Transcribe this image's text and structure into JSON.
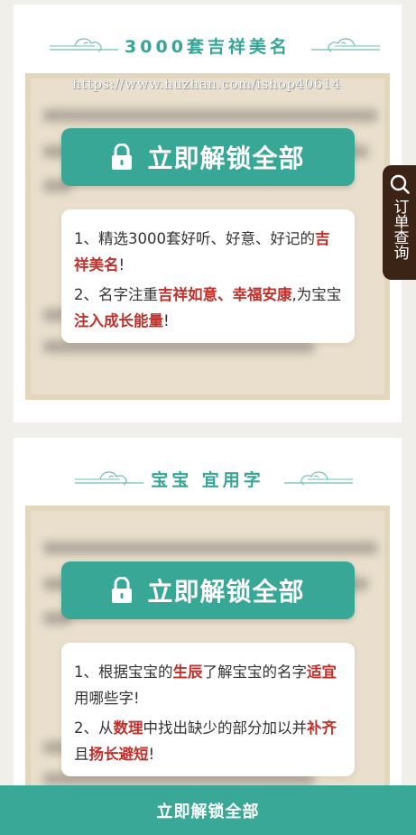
{
  "sections": [
    {
      "title": "3000套吉祥美名",
      "unlock_label": "立即解锁全部",
      "watermark": "https://www.huzhan.com/ishop40614",
      "items": [
        [
          {
            "t": "1、精选3000套好听、好意、好记的",
            "hl": false
          },
          {
            "t": "吉祥美名",
            "hl": true
          },
          {
            "t": "!",
            "hl": false
          }
        ],
        [
          {
            "t": "2、名字注重",
            "hl": false
          },
          {
            "t": "吉祥如意、幸福安康",
            "hl": true
          },
          {
            "t": ",为宝宝",
            "hl": false
          },
          {
            "t": "注入成长能量",
            "hl": true
          },
          {
            "t": "!",
            "hl": false
          }
        ]
      ]
    },
    {
      "title": "宝宝 宜用字",
      "unlock_label": "立即解锁全部",
      "items": [
        [
          {
            "t": "1、根据宝宝的",
            "hl": false
          },
          {
            "t": "生辰",
            "hl": true
          },
          {
            "t": "了解宝宝的名字",
            "hl": false
          },
          {
            "t": "适宜",
            "hl": true
          },
          {
            "t": "用哪些字!",
            "hl": false
          }
        ],
        [
          {
            "t": "2、从",
            "hl": false
          },
          {
            "t": "数理",
            "hl": true
          },
          {
            "t": "中找出缺少的部分加以并",
            "hl": false
          },
          {
            "t": "补齐",
            "hl": true
          },
          {
            "t": "且",
            "hl": false
          },
          {
            "t": "扬长避短",
            "hl": true
          },
          {
            "t": "!",
            "hl": false
          }
        ]
      ]
    }
  ],
  "side_tab": {
    "label": "订单查询",
    "icon": "search-icon"
  },
  "bottom_bar": {
    "label": "立即解锁全部"
  },
  "colors": {
    "accent": "#38a796",
    "highlight": "#c0312c",
    "side_tab_bg": "#3b2315",
    "paper": "#e9dfcc"
  }
}
